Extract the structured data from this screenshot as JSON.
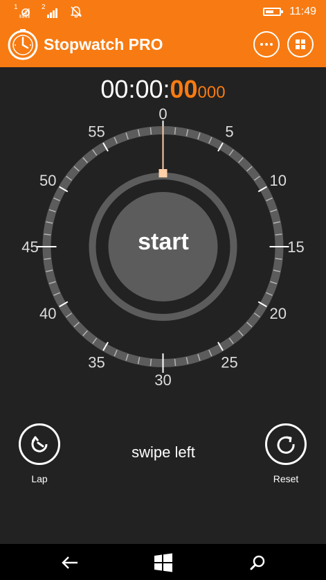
{
  "status_bar": {
    "sim1_label": "1",
    "sim2_label": "2",
    "time": "11:49",
    "battery_level": 0.6,
    "icons": [
      "sim1-no-signal-icon",
      "sim2-signal-icon",
      "quiet-hours-bell-icon",
      "battery-icon"
    ]
  },
  "app_bar": {
    "title": "Stopwatch PRO",
    "icons": [
      "stopwatch-logo-icon",
      "more-icon",
      "grid-icon"
    ]
  },
  "timer": {
    "minutes_seconds_prefix": "00:00:",
    "seconds": "00",
    "milliseconds": "000"
  },
  "dial": {
    "labels": [
      "0",
      "5",
      "10",
      "15",
      "20",
      "25",
      "30",
      "35",
      "40",
      "45",
      "50",
      "55"
    ],
    "hand_position": 0,
    "start_label": "start"
  },
  "controls": {
    "lap_label": "Lap",
    "reset_label": "Reset",
    "hint": "swipe left"
  },
  "nav_bar": {
    "icons": [
      "back-arrow-icon",
      "windows-start-icon",
      "search-icon"
    ]
  },
  "colors": {
    "accent": "#f77b12",
    "background": "#222222",
    "dial_ring": "#5c5c5c",
    "hand": "#ffcfa8"
  }
}
